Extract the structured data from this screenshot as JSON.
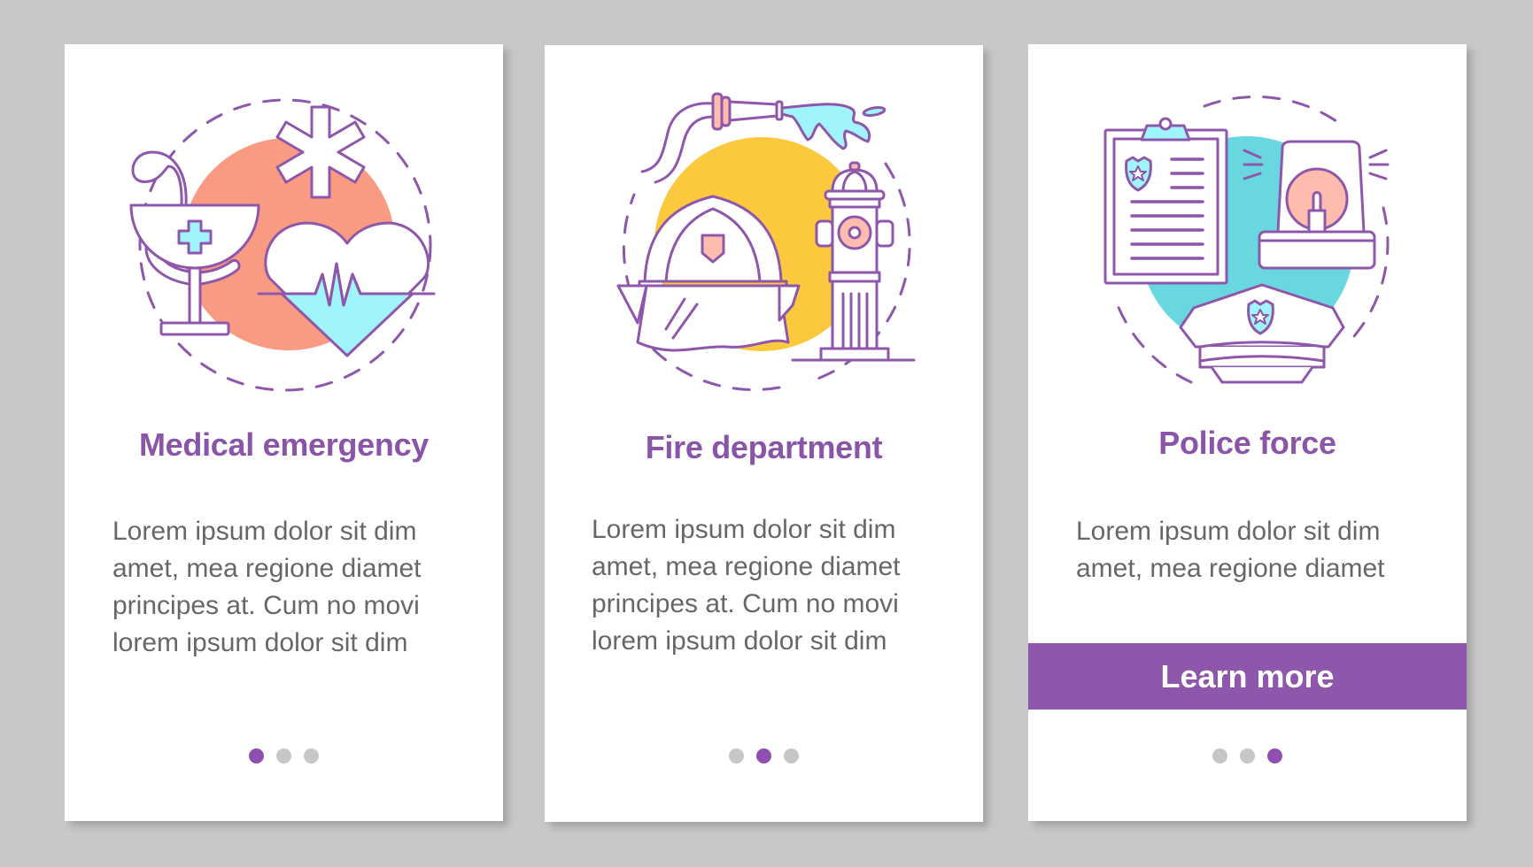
{
  "colors": {
    "background": "#c8c8c8",
    "accent": "#8e57ab",
    "title": "#8a55a8",
    "body_text": "#676767",
    "dot_inactive": "#c6c6c6",
    "dot_active": "#8e4fb0",
    "medical_circle": "#f99b82",
    "fire_circle": "#fcc93e",
    "police_circle": "#68d7df",
    "icon_stroke": "#8e57ab",
    "icon_fill_cyan": "#a0f4fb",
    "icon_fill_pink": "#fdbcae"
  },
  "cards": [
    {
      "id": "medical",
      "illustration": "medical-emergency-illustration",
      "title": "Medical emergency",
      "body_lines": [
        "Lorem ipsum dolor sit dim",
        "amet, mea regione diamet",
        "principes at. Cum no movi",
        "lorem ipsum dolor sit dim"
      ],
      "pagination": {
        "total": 3,
        "active": 1
      }
    },
    {
      "id": "fire",
      "illustration": "fire-department-illustration",
      "title": "Fire department",
      "body_lines": [
        "Lorem ipsum dolor sit dim",
        "amet, mea regione diamet",
        "principes at. Cum no movi",
        "lorem ipsum dolor sit dim"
      ],
      "pagination": {
        "total": 3,
        "active": 2
      }
    },
    {
      "id": "police",
      "illustration": "police-force-illustration",
      "title": "Police force",
      "body_lines": [
        "Lorem ipsum dolor sit dim",
        "amet, mea regione diamet"
      ],
      "button_label": "Learn more",
      "pagination": {
        "total": 3,
        "active": 3
      }
    }
  ]
}
